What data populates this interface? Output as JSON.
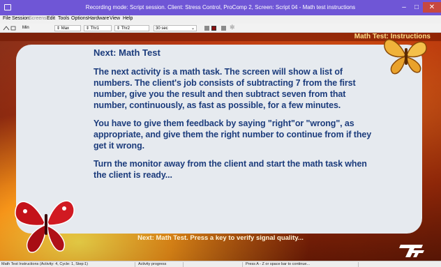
{
  "window": {
    "title": "Recording mode: Script session. Client: Stress Control, ProComp 2, Screen: Script 04 - Math test instructions",
    "minimize_glyph": "–",
    "maximize_glyph": "□",
    "close_glyph": "✕"
  },
  "menu": [
    "File",
    "Session",
    "Screens",
    "Edit",
    "Tools",
    "Options",
    "Hardware",
    "View",
    "Help"
  ],
  "toolbar": {
    "meter_label": "Min",
    "spin1": "Max",
    "spin2": "Thr1",
    "spin3": "Thr2",
    "duration": "30 sec"
  },
  "stage": {
    "header": "Math Test: Instructions",
    "heading": "Next: Math Test",
    "paragraphs": [
      "The next activity is a math task. The screen will show a list of numbers. The client's job consists of subtracting 7 from the first number, give you the result and then subtract seven from that number, continuously, as fast as possible, for a few minutes.",
      "You have to give them feedback by saying \"right\"or \"wrong\", as appropriate, and give them the right number to continue from if they get it wrong.",
      "Turn the monitor away from the client and start the math task when the client is ready..."
    ],
    "footer": "Next: Math Test. Press a key to verify signal quality...",
    "logo_text": "TT"
  },
  "status": {
    "left": "Math Test Instructions (Activity: 4, Cycle: 1, Step:1)",
    "middle": "Activity progress",
    "right": "Press A - Z or space bar to continue..."
  },
  "colors": {
    "titlebar": "#6f56d6",
    "text_blue": "#1c3c7c",
    "header_gold": "#ffe08a"
  }
}
